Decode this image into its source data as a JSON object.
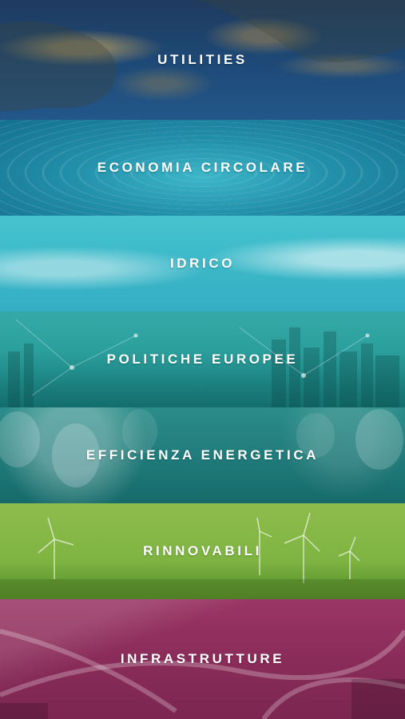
{
  "categories": [
    {
      "label": "UTILITIES"
    },
    {
      "label": "ECONOMIA CIRCOLARE"
    },
    {
      "label": "IDRICO"
    },
    {
      "label": "POLITICHE EUROPEE"
    },
    {
      "label": "EFFICIENZA ENERGETICA"
    },
    {
      "label": "RINNOVABILI"
    },
    {
      "label": "INFRASTRUTTURE"
    }
  ],
  "colors": {
    "utilities": "#1e4a78",
    "economia_circolare": "#2390aa",
    "idrico": "#3bb8c8",
    "politiche_europee": "#279b98",
    "efficienza_energetica": "#207a79",
    "rinnovabili": "#7eb442",
    "infrastrutture": "#8a2c5a"
  }
}
